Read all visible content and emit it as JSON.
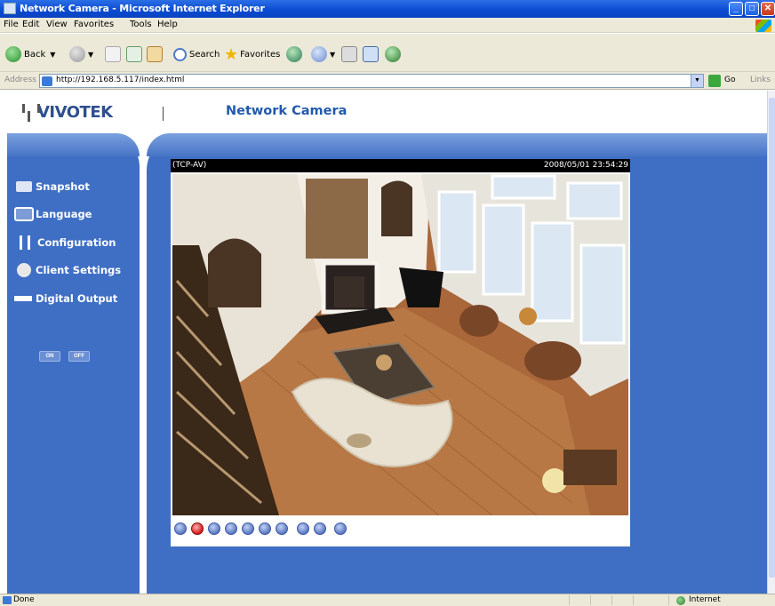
{
  "window": {
    "title": "Network Camera - Microsoft Internet Explorer",
    "minimize_icon": "minimize-icon",
    "maximize_icon": "maximize-icon",
    "close_icon": "close-icon"
  },
  "menubar": {
    "items": [
      "File",
      "Edit",
      "View",
      "Favorites",
      "Tools",
      "Help"
    ]
  },
  "toolbar": {
    "back_label": "Back",
    "search_label": "Search",
    "favorites_label": "Favorites"
  },
  "address": {
    "label": "Address",
    "url": "http://192.168.5.117/index.html",
    "go_label": "Go",
    "links_label": "Links"
  },
  "page": {
    "logo_text": "VIVOTEK",
    "title": "Network Camera",
    "menu": [
      {
        "label": "Snapshot",
        "icon": "camera-icon"
      },
      {
        "label": "Language",
        "icon": "language-icon"
      },
      {
        "label": "Configuration",
        "icon": "configuration-icon"
      },
      {
        "label": "Client Settings",
        "icon": "client-settings-icon"
      },
      {
        "label": "Digital Output",
        "icon": "digital-output-icon"
      }
    ],
    "digital_output": {
      "on_label": "ON",
      "off_label": "OFF"
    },
    "video": {
      "format": "(TCP-AV)",
      "timestamp": "2008/05/01 23:54:29"
    },
    "controls": [
      "zoom-icon",
      "record-icon",
      "snapshot-icon",
      "pause-icon",
      "stop-icon",
      "volume-icon",
      "mute-icon",
      "talk-icon",
      "mic-icon",
      "fullscreen-icon"
    ]
  },
  "status": {
    "text": "Done",
    "zone": "Internet"
  },
  "colors": {
    "panel_blue": "#3f6fc4",
    "title_blue": "#2259ad",
    "xp_titlebar": "#0a4ad0"
  }
}
